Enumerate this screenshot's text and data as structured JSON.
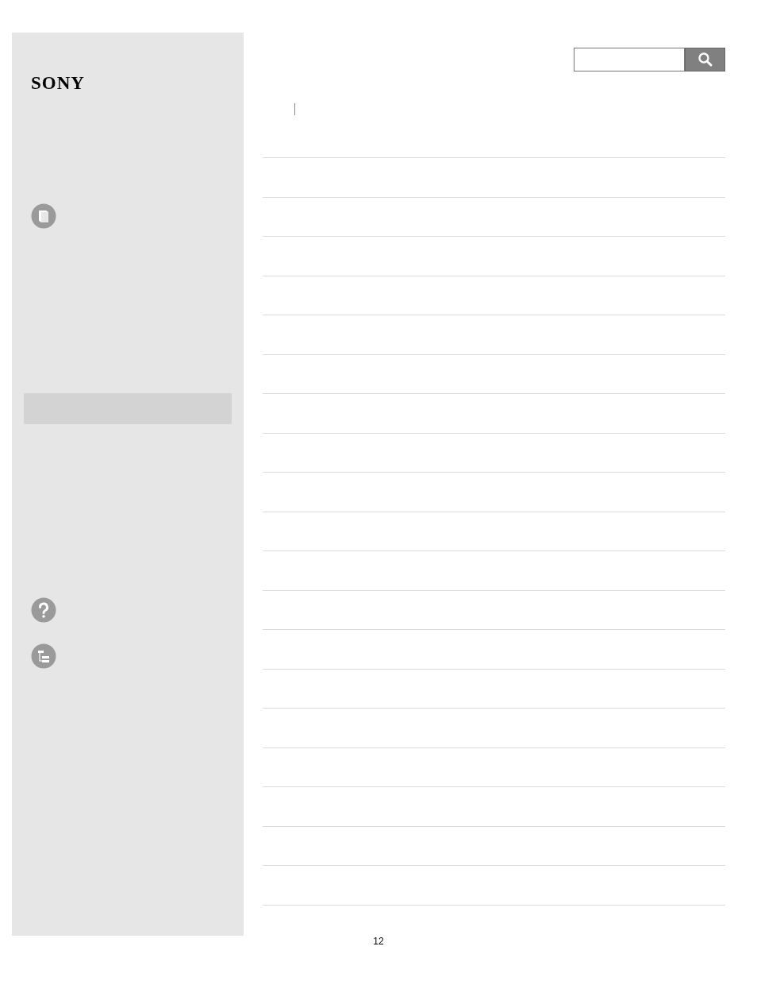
{
  "logo": {
    "text": "SONY"
  },
  "page_number": "12"
}
